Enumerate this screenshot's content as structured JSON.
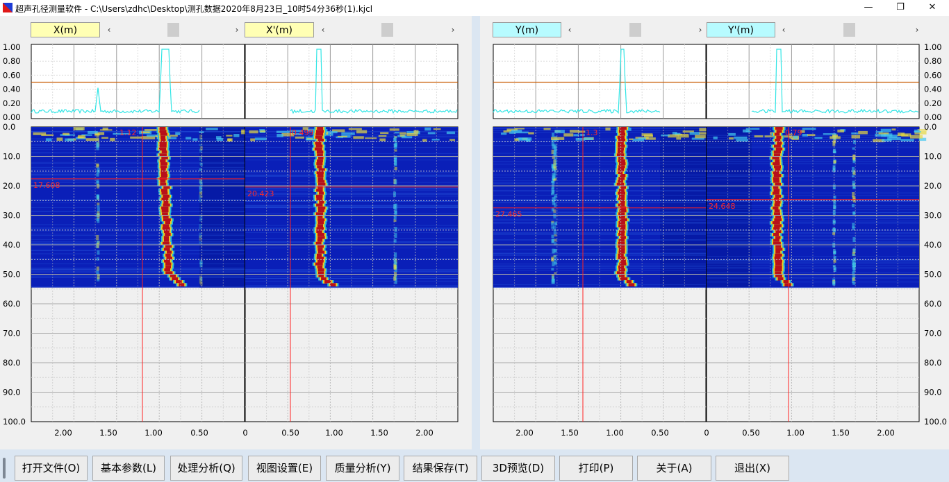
{
  "window": {
    "title": "超声孔径测量软件 - C:\\Users\\zdhc\\Desktop\\测孔数据2020年8月23日_10时54分36秒(1).kjcl",
    "controls": {
      "minimize": "—",
      "restore": "❐",
      "close": "✕"
    }
  },
  "panels": [
    {
      "id": "x",
      "label": "X(m)",
      "marker_value": "17.608",
      "cursor_value": "1.12",
      "color": "#ffffb4"
    },
    {
      "id": "xp",
      "label": "X'(m)",
      "marker_value": "20.423",
      "cursor_value": "0.499",
      "color": "#ffffb4"
    },
    {
      "id": "y",
      "label": "Y(m)",
      "marker_value": "27.465",
      "cursor_value": "1.3",
      "color": "#b7fbff"
    },
    {
      "id": "yp",
      "label": "Y'(m)",
      "marker_value": "24.648",
      "cursor_value": "0.79",
      "color": "#b7fbff"
    }
  ],
  "axes": {
    "amplitude_ticks": [
      "1.00",
      "0.80",
      "0.60",
      "0.40",
      "0.20",
      "0.00"
    ],
    "depth_ticks": [
      "0.0",
      "10.0",
      "20.0",
      "30.0",
      "40.0",
      "50.0",
      "60.0",
      "70.0",
      "80.0",
      "90.0",
      "100.0"
    ],
    "left_x_ticks": [
      "2.00",
      "1.50",
      "1.00",
      "0.50",
      "0"
    ],
    "right_x_ticks": [
      "0.50",
      "1.00",
      "1.50",
      "2.00"
    ],
    "center_x_ticks": [
      "0.50",
      "1.00",
      "1.50",
      "2.00"
    ],
    "threshold": 0.5,
    "measured_depth_max": 54.5
  },
  "colors": {
    "heatmap_background": "#0a1fb8",
    "wall_hot": "#b8101a",
    "wall_warm": "#f0d020",
    "trace": "#30e5e5",
    "threshold_line": "#c85a00",
    "marker_line": "#ff2222"
  },
  "toolbar": [
    {
      "label": "打开文件(O)",
      "name": "open-file-button"
    },
    {
      "label": "基本参数(L)",
      "name": "basic-params-button"
    },
    {
      "label": "处理分析(Q)",
      "name": "process-analysis-button"
    },
    {
      "label": "视图设置(E)",
      "name": "view-settings-button"
    },
    {
      "label": "质量分析(Y)",
      "name": "quality-analysis-button"
    },
    {
      "label": "结果保存(T)",
      "name": "save-results-button"
    },
    {
      "label": "3D预览(D)",
      "name": "preview-3d-button"
    },
    {
      "label": "打印(P)",
      "name": "print-button"
    },
    {
      "label": "关于(A)",
      "name": "about-button"
    },
    {
      "label": "退出(X)",
      "name": "exit-button"
    }
  ]
}
